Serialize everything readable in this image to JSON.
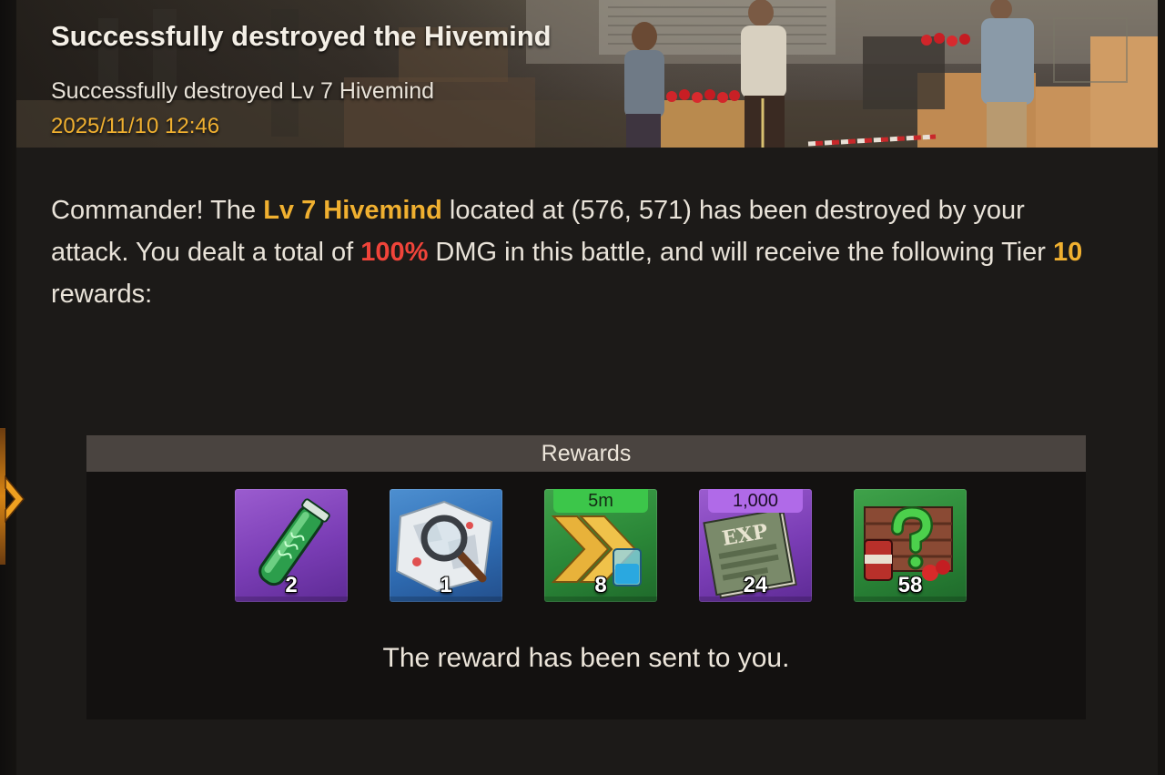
{
  "header": {
    "title": "Successfully destroyed the Hivemind",
    "subtitle": "Successfully destroyed Lv 7 Hivemind",
    "timestamp": "2025/11/10 12:46"
  },
  "message": {
    "part1": "Commander! The ",
    "target": "Lv 7 Hivemind",
    "part2": " located at (576, 571) has been destroyed by your attack. You dealt a total of ",
    "damage": "100%",
    "part3": " DMG in this battle, and will receive the following Tier ",
    "tier": "10",
    "part4": " rewards:"
  },
  "rewards": {
    "header": "Rewards",
    "items": [
      {
        "icon": "green-serum-vial-icon",
        "rarity": "purple",
        "tag": "",
        "count": "2"
      },
      {
        "icon": "magnifying-glass-map-icon",
        "rarity": "blue",
        "tag": "",
        "count": "1"
      },
      {
        "icon": "research-speedup-icon",
        "rarity": "green",
        "tag": "5m",
        "count": "8"
      },
      {
        "icon": "exp-book-icon",
        "rarity": "purple",
        "tag": "1,000",
        "count": "24"
      },
      {
        "icon": "random-resource-crate-icon",
        "rarity": "green",
        "tag": "",
        "count": "58"
      }
    ],
    "sent_message": "The reward has been sent to you."
  },
  "colors": {
    "highlight_yellow": "#f0b030",
    "highlight_red": "#f0443a",
    "panel_bg": "#131110",
    "body_bg": "#1c1a18"
  }
}
